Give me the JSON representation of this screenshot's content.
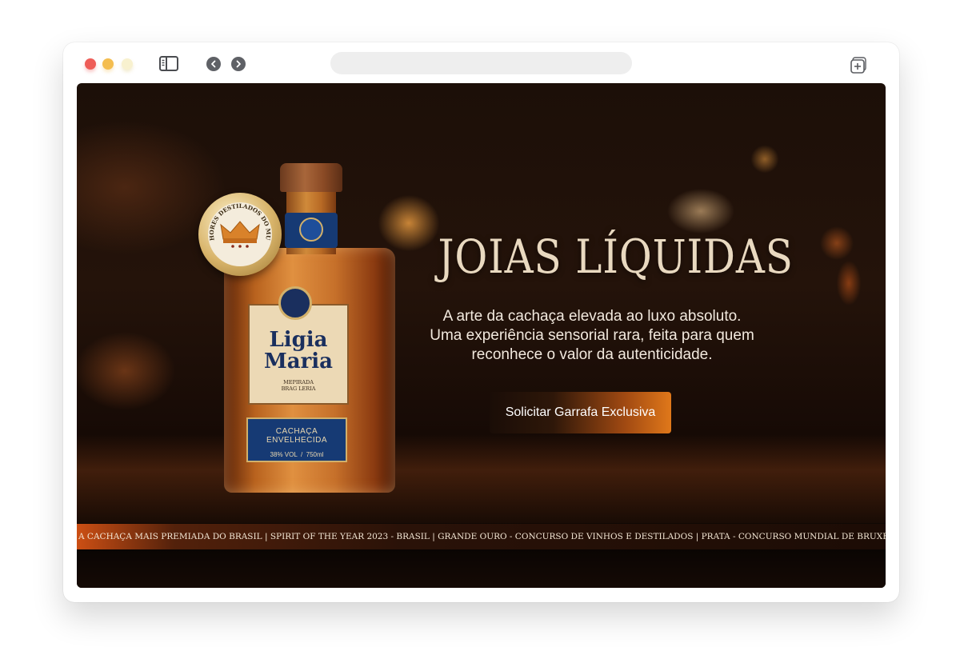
{
  "browser": {
    "sidebar_icon": "sidebar-icon",
    "back_icon": "chevron-left-icon",
    "forward_icon": "chevron-right-icon",
    "new_tab_icon": "new-tab-icon",
    "address_value": ""
  },
  "hero": {
    "title": "JOIAS LÍQUIDAS",
    "subtitle_lines": [
      "A arte da cachaça elevada ao luxo absoluto.",
      "Uma experiência sensorial rara, feita para quem",
      "reconhece o valor da autenticidade."
    ],
    "cta_label": "Solicitar Garrafa Exclusiva",
    "accent_color": "#e0781a"
  },
  "product": {
    "brand_line1": "Ligia",
    "brand_line2": "Maria",
    "label_small1": "MEPIRADA",
    "label_small2": "BRAG LERIA",
    "type": "CACHAÇA ENVELHECIDA",
    "abv": "38% VOL",
    "volume": "750ml",
    "medal_text": "MELHORES DESTILADOS DO MUNDO"
  },
  "ticker": {
    "text": "A CACHAÇA MAIS PREMIADA DO BRASIL | SPIRIT OF THE YEAR 2023 - BRASIL | GRANDE OURO - CONCURSO DE VINHOS E DESTILADOS | PRATA - CONCURSO MUNDIAL DE BRUXELAS | OURO - CACHAÇA TRADE FAIR"
  }
}
